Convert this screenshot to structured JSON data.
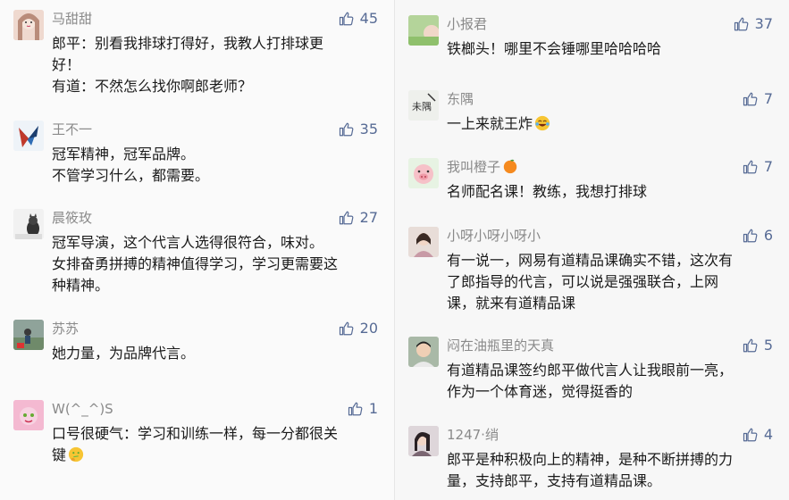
{
  "left_comments": [
    {
      "name": "马甜甜",
      "likes": "45",
      "lines": [
        "郎平：别看我排球打得好，我教人打排球更",
        "好！",
        "有道：不然怎么找你啊郎老师？"
      ],
      "avatar": "avatar-girl"
    },
    {
      "name": "王不一",
      "likes": "35",
      "lines": [
        "冠军精神，冠军品牌。",
        "不管学习什么，都需要。"
      ],
      "avatar": "avatar-kite"
    },
    {
      "name": "晨筱玫",
      "likes": "27",
      "lines": [
        "冠军导演，这个代言人选得很符合，味对。",
        "女排奋勇拼搏的精神值得学习，学习更需要这",
        "种精神。"
      ],
      "avatar": "avatar-cat"
    },
    {
      "name": "苏苏",
      "likes": "20",
      "lines": [
        "她力量，为品牌代言。"
      ],
      "avatar": "avatar-outdoor"
    },
    {
      "name": "W(^_^)S",
      "likes": "1",
      "lines": [
        "口号很硬气：学习和训练一样，每一分都很关",
        "键"
      ],
      "avatar": "avatar-pink"
    }
  ],
  "right_comments": [
    {
      "name": "小报君",
      "likes": "37",
      "lines": [
        "铁榔头！哪里不会锤哪里哈哈哈哈"
      ],
      "avatar": "avatar-green"
    },
    {
      "name": "东隅",
      "likes": "7",
      "lines": [
        "一上来就王炸"
      ],
      "avatar": "avatar-calligraphy"
    },
    {
      "name": "我叫橙子",
      "likes": "7",
      "lines": [
        "名师配名课！教练，我想打排球"
      ],
      "avatar": "avatar-pig"
    },
    {
      "name": "小呀小呀小呀小",
      "likes": "6",
      "lines": [
        "有一说一，网易有道精品课确实不错，这次有",
        "了郎指导的代言，可以说是强强联合，上网",
        "课，就来有道精品课"
      ],
      "avatar": "avatar-woman"
    },
    {
      "name": "闷在油瓶里的天真",
      "likes": "5",
      "lines": [
        "有道精品课签约郎平做代言人让我眼前一亮，",
        "作为一个体育迷，觉得挺香的"
      ],
      "avatar": "avatar-man"
    },
    {
      "name": "1247·绡",
      "likes": "4",
      "lines": [
        "郎平是种积极向上的精神，是种不断拼搏的力",
        "量，支持郎平，支持有道精品课。"
      ],
      "avatar": "avatar-girl2"
    }
  ],
  "colors": {
    "accent": "#576b95",
    "name": "#8a8a8a",
    "text": "#1a1a1a"
  },
  "icons": {
    "like": "thumbs-up-icon",
    "laugh": "laughing-emoji",
    "think": "thinking-emoji",
    "orange": "orange-emoji"
  }
}
